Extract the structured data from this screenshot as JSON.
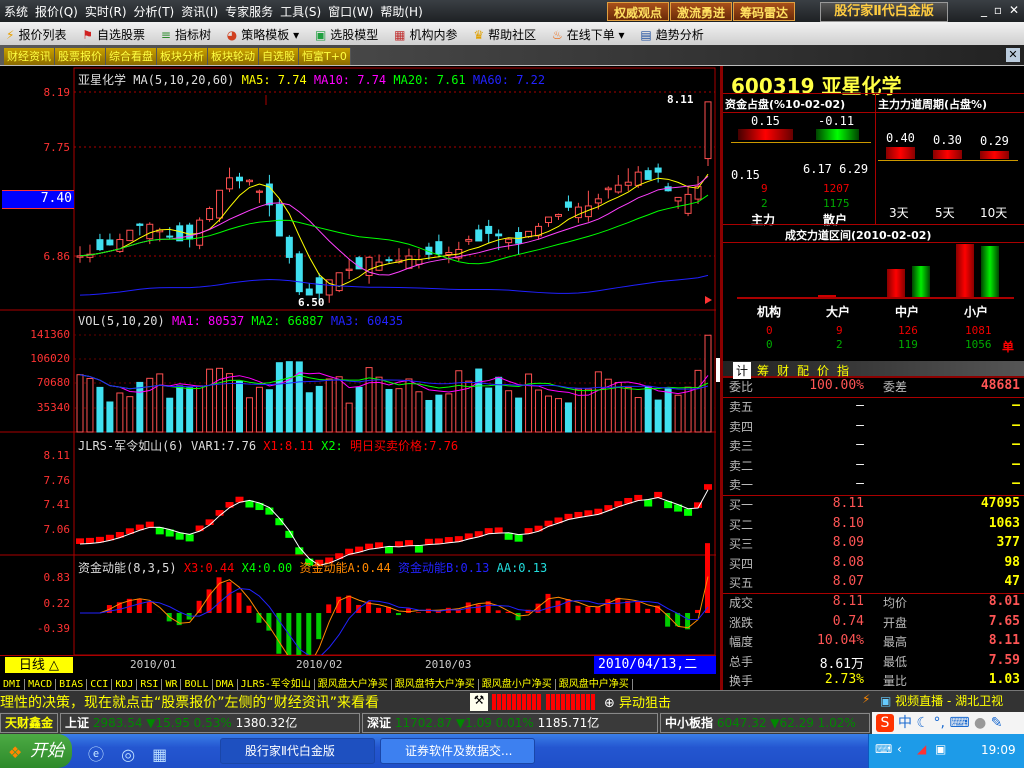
{
  "menu": [
    "系统",
    "报价(Q)",
    "实时(R)",
    "分析(T)",
    "资讯(I)",
    "专家服务",
    "工具(S)",
    "窗口(W)",
    "帮助(H)"
  ],
  "top_buttons": [
    "权威观点",
    "激流勇进",
    "筹码雷达"
  ],
  "brand": "股行家Ⅱ代白金版",
  "win": {
    "min": "_",
    "max": "▫",
    "close": "✕"
  },
  "toolbar": [
    {
      "icon": "⚡",
      "label": "报价列表"
    },
    {
      "icon": "⚑",
      "label": "自选股票"
    },
    {
      "icon": "≡",
      "label": "指标树"
    },
    {
      "icon": "◕",
      "label": "策略模板 ▾"
    },
    {
      "icon": "▣",
      "label": "选股模型"
    },
    {
      "icon": "▦",
      "label": "机构内参"
    },
    {
      "icon": "♛",
      "label": "帮助社区"
    },
    {
      "icon": "♨",
      "label": "在线下单 ▾"
    },
    {
      "icon": "▤",
      "label": "趋势分析"
    }
  ],
  "tabs": [
    "财经资讯",
    "股票报价",
    "综合看盘",
    "板块分析",
    "板块轮动",
    "自选股",
    "恒富T+0"
  ],
  "tab_close": "✕",
  "main_chart": {
    "name": "亚星化学",
    "ma_label": "MA(5,10,20,60)",
    "ma5": "MA5: 7.74",
    "ma10": "MA10: 7.74",
    "ma20": "MA20: 7.61",
    "ma60": "MA60: 7.22",
    "axis": [
      "8.19",
      "7.75",
      "6.86"
    ],
    "current": "7.40",
    "high_mark": "8.11",
    "low_mark": "6.50"
  },
  "vol_chart": {
    "label": "VOL(5,10,20)",
    "ma1": "MA1: 80537",
    "ma2": "MA2: 66887",
    "ma3": "MA3: 60435",
    "axis": [
      "141360",
      "106020",
      "70680",
      "35340"
    ]
  },
  "jlrs_chart": {
    "label": "JLRS-军令如山(6) VAR1:7.76",
    "x1": "X1:8.11",
    "x2": "X2:",
    "price": "明日买卖价格:7.76",
    "axis": [
      "8.11",
      "7.76",
      "7.41",
      "7.06"
    ]
  },
  "zj_chart": {
    "label": "资金动能(8,3,5)",
    "x3": "X3:0.44",
    "x4": "X4:0.00",
    "a": "资金动能A:0.44",
    "b": "资金动能B:0.13",
    "aa": "AA:0.13",
    "axis": [
      "0.83",
      "0.22",
      "-0.39"
    ]
  },
  "date_axis": {
    "period": "日线 △",
    "dates": [
      "2010/01",
      "2010/02",
      "2010/03"
    ],
    "current": "2010/04/13,二"
  },
  "indicators": [
    "DMI",
    "MACD",
    "BIAS",
    "CCI",
    "KDJ",
    "RSI",
    "WR",
    "BOLL",
    "DMA",
    "JLRS-军令如山",
    "跟风盘大户净买",
    "跟风盘特大户净买",
    "跟风盘小户净买",
    "跟风盘中户净买"
  ],
  "right": {
    "code": "600319",
    "name": "亚星化学",
    "zj_title": "资金占盘(%10-02-02)",
    "zl_title": "主力力道周期(占盘%)",
    "zj_top": [
      "0.15",
      "-0.11"
    ],
    "zj_left": "0.15",
    "zj_mid": [
      "6.17",
      "6.29"
    ],
    "zl_red": [
      "9",
      "1207"
    ],
    "zl_green": [
      "2",
      "1175"
    ],
    "zl_labels": [
      "主力",
      "散户"
    ],
    "cycle_vals": [
      "0.40",
      "0.30",
      "0.29"
    ],
    "cycle_labels": [
      "3天",
      "5天",
      "10天"
    ],
    "cj_title": "成交力道区间(2010-02-02)",
    "cj_cats": [
      "机构",
      "大户",
      "中户",
      "小户"
    ],
    "cj_red": [
      "0",
      "9",
      "126",
      "1081"
    ],
    "cj_green": [
      "0",
      "2",
      "119",
      "1056"
    ],
    "cj_unit": "单",
    "subtabs": [
      "计",
      "筹",
      "财",
      "配",
      "价",
      "指"
    ],
    "weibi": {
      "l1": "委比",
      "v1": "100.00%",
      "l2": "委差",
      "v2": "48681"
    },
    "sell": [
      {
        "l": "卖五",
        "p": "—",
        "v": "—"
      },
      {
        "l": "卖四",
        "p": "—",
        "v": "—"
      },
      {
        "l": "卖三",
        "p": "—",
        "v": "—"
      },
      {
        "l": "卖二",
        "p": "—",
        "v": "—"
      },
      {
        "l": "卖一",
        "p": "—",
        "v": "—"
      }
    ],
    "buy": [
      {
        "l": "买一",
        "p": "8.11",
        "v": "47095"
      },
      {
        "l": "买二",
        "p": "8.10",
        "v": "1063"
      },
      {
        "l": "买三",
        "p": "8.09",
        "v": "377"
      },
      {
        "l": "买四",
        "p": "8.08",
        "v": "98"
      },
      {
        "l": "买五",
        "p": "8.07",
        "v": "47"
      }
    ],
    "stats": [
      {
        "l1": "成交",
        "v1": "8.11",
        "l2": "均价",
        "v2": "8.01"
      },
      {
        "l1": "涨跌",
        "v1": "0.74",
        "l2": "开盘",
        "v2": "7.65"
      },
      {
        "l1": "幅度",
        "v1": "10.04%",
        "l2": "最高",
        "v2": "8.11"
      },
      {
        "l1": "总手",
        "v1": "8.61万",
        "l2": "最低",
        "v2": "7.59"
      },
      {
        "l1": "换手",
        "v1": "2.73%",
        "l2": "量比",
        "v2": "1.03"
      }
    ]
  },
  "ticker": {
    "text": "理性的决策，现在就点击“股票报价”左侧的“财经资讯”来看看",
    "alert": "异动狙击",
    "video": "视频直播 - 湖北卫视"
  },
  "index": {
    "brand": "天财鑫金",
    "sh_name": "上证",
    "sh": "2983.54 ▼15.95 0.53%",
    "sh_amt": "1380.32亿",
    "sz_name": "深证",
    "sz": "11702.87 ▼1.09 0.01%",
    "sz_amt": "1185.71亿",
    "zx_name": "中小板指",
    "zx": "6047.32 ▼62.29 1.02%"
  },
  "ime": "中",
  "taskbar": {
    "start": "开始",
    "tasks": [
      "股行家Ⅱ代白金版",
      "证券软件及数据交..."
    ],
    "clock": "19:09"
  },
  "price_path": [
    [
      0,
      6.9
    ],
    [
      3,
      6.95
    ],
    [
      7,
      7.1
    ],
    [
      11,
      7.0
    ],
    [
      15,
      7.5
    ],
    [
      17,
      7.45
    ],
    [
      19,
      7.25
    ],
    [
      22,
      6.62
    ],
    [
      24,
      6.55
    ],
    [
      27,
      6.78
    ],
    [
      31,
      6.85
    ],
    [
      36,
      6.9
    ],
    [
      40,
      7.02
    ],
    [
      44,
      6.95
    ],
    [
      48,
      7.2
    ],
    [
      52,
      7.35
    ],
    [
      56,
      7.55
    ],
    [
      58,
      7.5
    ],
    [
      60,
      7.3
    ],
    [
      62,
      7.45
    ],
    [
      63,
      8.11
    ]
  ],
  "colors": {
    "up": "#ff5050",
    "down": "#40e0f0",
    "ma5": "#ffff00",
    "ma10": "#ff40ff",
    "ma20": "#00ff00",
    "ma60": "#2020ff"
  }
}
